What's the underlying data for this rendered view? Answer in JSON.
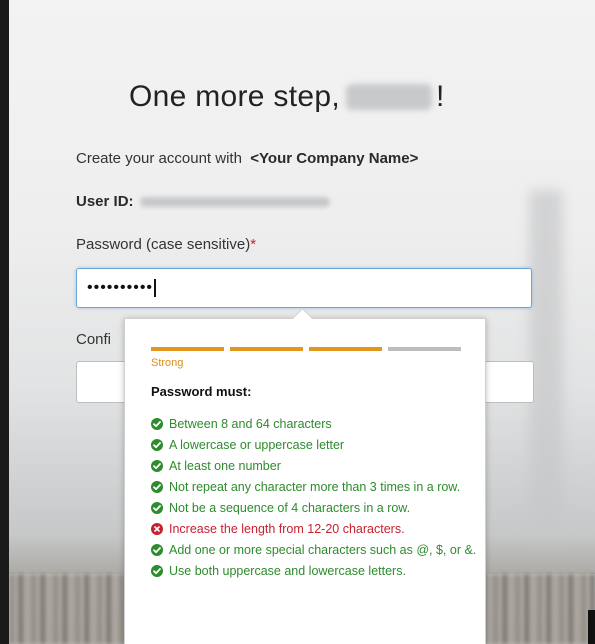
{
  "heading": {
    "prefix": "One more step,",
    "suffix": "!"
  },
  "intro": {
    "text": "Create your account with",
    "company": "<Your Company Name>"
  },
  "user_id": {
    "label": "User ID:"
  },
  "password": {
    "label": "Password (case sensitive)",
    "required_mark": "*",
    "value": "••••••••••"
  },
  "confirm": {
    "label": "Confi"
  },
  "strength_meter": {
    "label": "Strong",
    "level": 0.75,
    "segments_filled": 3,
    "segments_total": 4,
    "colors": {
      "filled": "#e2961e",
      "empty": "#bdbdbd",
      "label": "#d8901a"
    }
  },
  "requirements": {
    "heading": "Password must:",
    "items": [
      {
        "text": "Between 8 and 64 characters",
        "status": "pass"
      },
      {
        "text": "A lowercase or uppercase letter",
        "status": "pass"
      },
      {
        "text": "At least one number",
        "status": "pass"
      },
      {
        "text": "Not repeat any character more than 3 times in a row.",
        "status": "pass"
      },
      {
        "text": "Not be a sequence of 4 characters in a row.",
        "status": "pass"
      },
      {
        "text": "Increase the length from 12-20 characters.",
        "status": "fail"
      },
      {
        "text": "Add one or more special characters such as @, $, or &.",
        "status": "pass"
      },
      {
        "text": "Use both uppercase and lowercase letters.",
        "status": "pass"
      }
    ],
    "colors": {
      "pass": "#2e8b2e",
      "fail": "#c8202e"
    }
  },
  "icons": {
    "pass": "check-circle-icon",
    "fail": "x-circle-icon"
  },
  "colors": {
    "required": "#d21e2b",
    "focus_border": "#6aa9d6"
  }
}
